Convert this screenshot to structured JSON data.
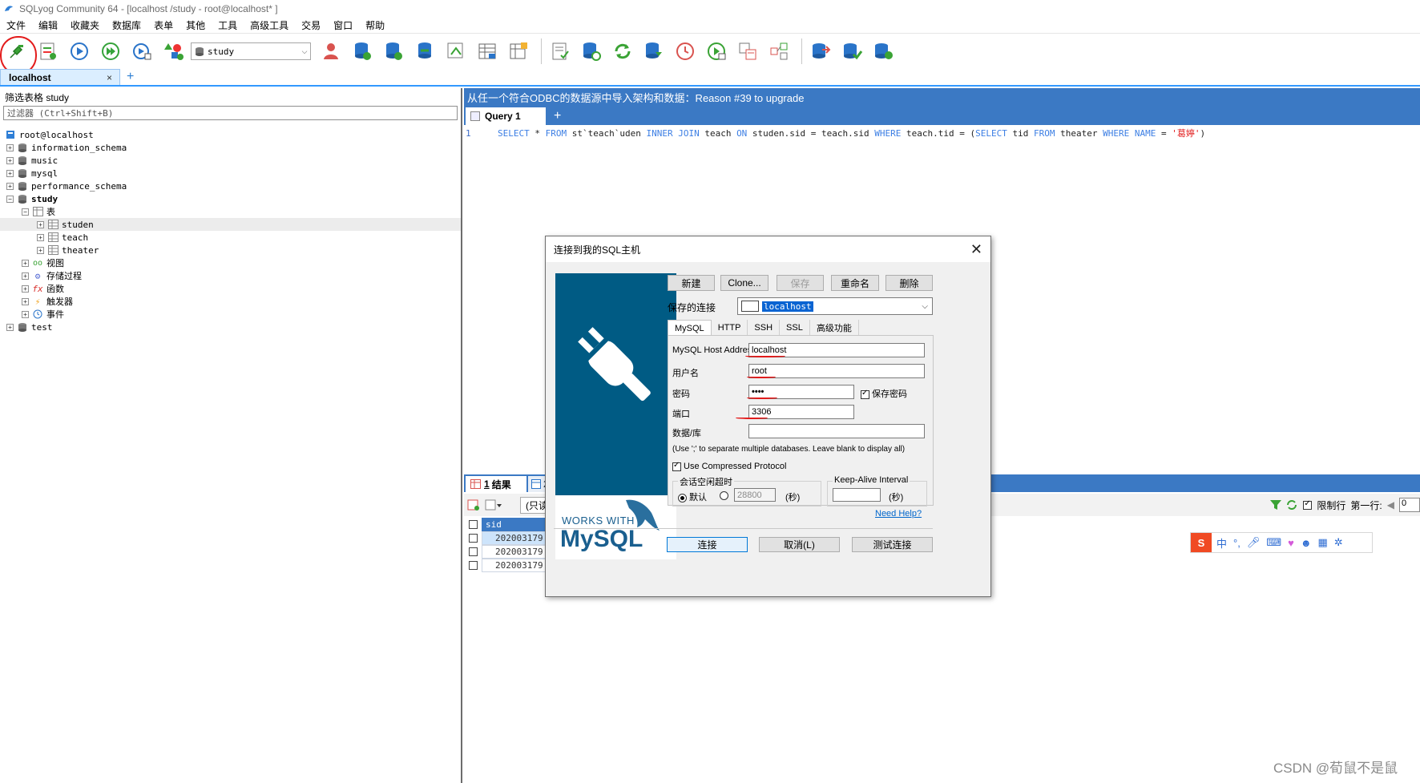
{
  "window": {
    "title": "SQLyog Community 64 - [localhost /study - root@localhost* ]"
  },
  "menu": {
    "items": [
      "文件",
      "编辑",
      "收藏夹",
      "数据库",
      "表单",
      "其他",
      "工具",
      "高级工具",
      "交易",
      "窗口",
      "帮助"
    ]
  },
  "toolbar": {
    "database_select": "study",
    "icons": [
      "new-connection-icon",
      "new-query-icon",
      "execute-query-icon",
      "execute-all-icon",
      "execute-edit-icon",
      "schema-designer-icon",
      "user-manager-icon",
      "import-db-icon",
      "export-db-icon",
      "backup-db-icon",
      "query-builder-icon",
      "table-data-icon",
      "table-structure-icon",
      "sql-scheduler-icon",
      "restore-db-icon",
      "refresh-icon",
      "copy-db-icon",
      "scheduled-job-icon",
      "notification-icon",
      "sync-schema-icon",
      "visual-diff-icon",
      "data-sync-icon",
      "migrate-icon",
      "sync-db-icon"
    ]
  },
  "connection_tab": {
    "label": "localhost",
    "close": "×",
    "add": "+"
  },
  "left_panel": {
    "filter_label": "筛选表格 study",
    "filter_placeholder": "过滤器 (Ctrl+Shift+B)",
    "tree": {
      "root": "root@localhost",
      "databases": [
        {
          "name": "information_schema"
        },
        {
          "name": "music"
        },
        {
          "name": "mysql"
        },
        {
          "name": "performance_schema"
        },
        {
          "name": "study"
        },
        {
          "name": "test"
        }
      ],
      "study_children": {
        "tables_label": "表",
        "tables": [
          "studen",
          "teach",
          "theater"
        ],
        "views_label": "视图",
        "procs_label": "存储过程",
        "funcs_label": "函数",
        "triggers_label": "触发器",
        "events_label": "事件"
      }
    }
  },
  "right_header": {
    "text": "从任一个符合ODBC的数据源中导入架构和数据：Reason #39 to upgrade"
  },
  "query_tab": {
    "label": "Query 1",
    "add": "+"
  },
  "editor": {
    "line_number": "1",
    "sql_parts": {
      "p1": "SELECT",
      "p2": " * ",
      "p3": "FROM",
      "p4": " st`teach`uden ",
      "p5": "INNER JOIN",
      "p6": " teach ",
      "p7": "ON",
      "p8": " studen.sid = teach.sid ",
      "p9": "WHERE",
      "p10": " teach.tid = (",
      "p11": "SELECT",
      "p12": " tid ",
      "p13": "FROM",
      "p14": " theater ",
      "p15": "WHERE",
      "p16": " ",
      "p17": "NAME",
      "p18": " = ",
      "p19": "'葛婷'",
      "p20": ")"
    }
  },
  "result": {
    "tab1_num": "1",
    "tab1_label": "结果",
    "tab2_label": "2",
    "readonly_label": "(只读",
    "limit_label": "限制行",
    "first_row_label": "第一行:",
    "first_row_value": "0",
    "columns": [
      "sid"
    ],
    "rows": [
      "202003179",
      "202003179",
      "202003179"
    ]
  },
  "dialog": {
    "title": "连接到我的SQL主机",
    "close": "✕",
    "brand_top": "WORKS WITH",
    "brand_main": "MySQL",
    "buttons": {
      "new": "新建",
      "clone": "Clone...",
      "save": "保存",
      "rename": "重命名",
      "delete": "删除"
    },
    "saved_connection_label": "保存的连接",
    "saved_connection_value": "localhost",
    "tabs": [
      "MySQL",
      "HTTP",
      "SSH",
      "SSL",
      "高级功能"
    ],
    "fields": {
      "host_label": "MySQL Host Address",
      "host_value": "localhost",
      "user_label": "用户名",
      "user_value": "root",
      "password_label": "密码",
      "password_value": "••••",
      "save_password_label": "保存密码",
      "port_label": "端口",
      "port_value": "3306",
      "database_label": "数据/库",
      "database_value": "",
      "database_hint": "(Use ';' to separate multiple databases. Leave blank to display all)",
      "compressed_label": "Use Compressed Protocol",
      "session_timeout_label": "会话空闲超时",
      "default_label": "默认",
      "timeout_value": "28800",
      "seconds1": "(秒)",
      "keepalive_label": "Keep-Alive Interval",
      "keepalive_value": "",
      "seconds2": "(秒)",
      "help_link": "Need Help?"
    },
    "footer": {
      "connect": "连接",
      "cancel": "取消(L)",
      "test": "测试连接"
    }
  },
  "ime": {
    "logo": "S",
    "lang": "中"
  },
  "watermark": "CSDN @荀鼠不是鼠"
}
